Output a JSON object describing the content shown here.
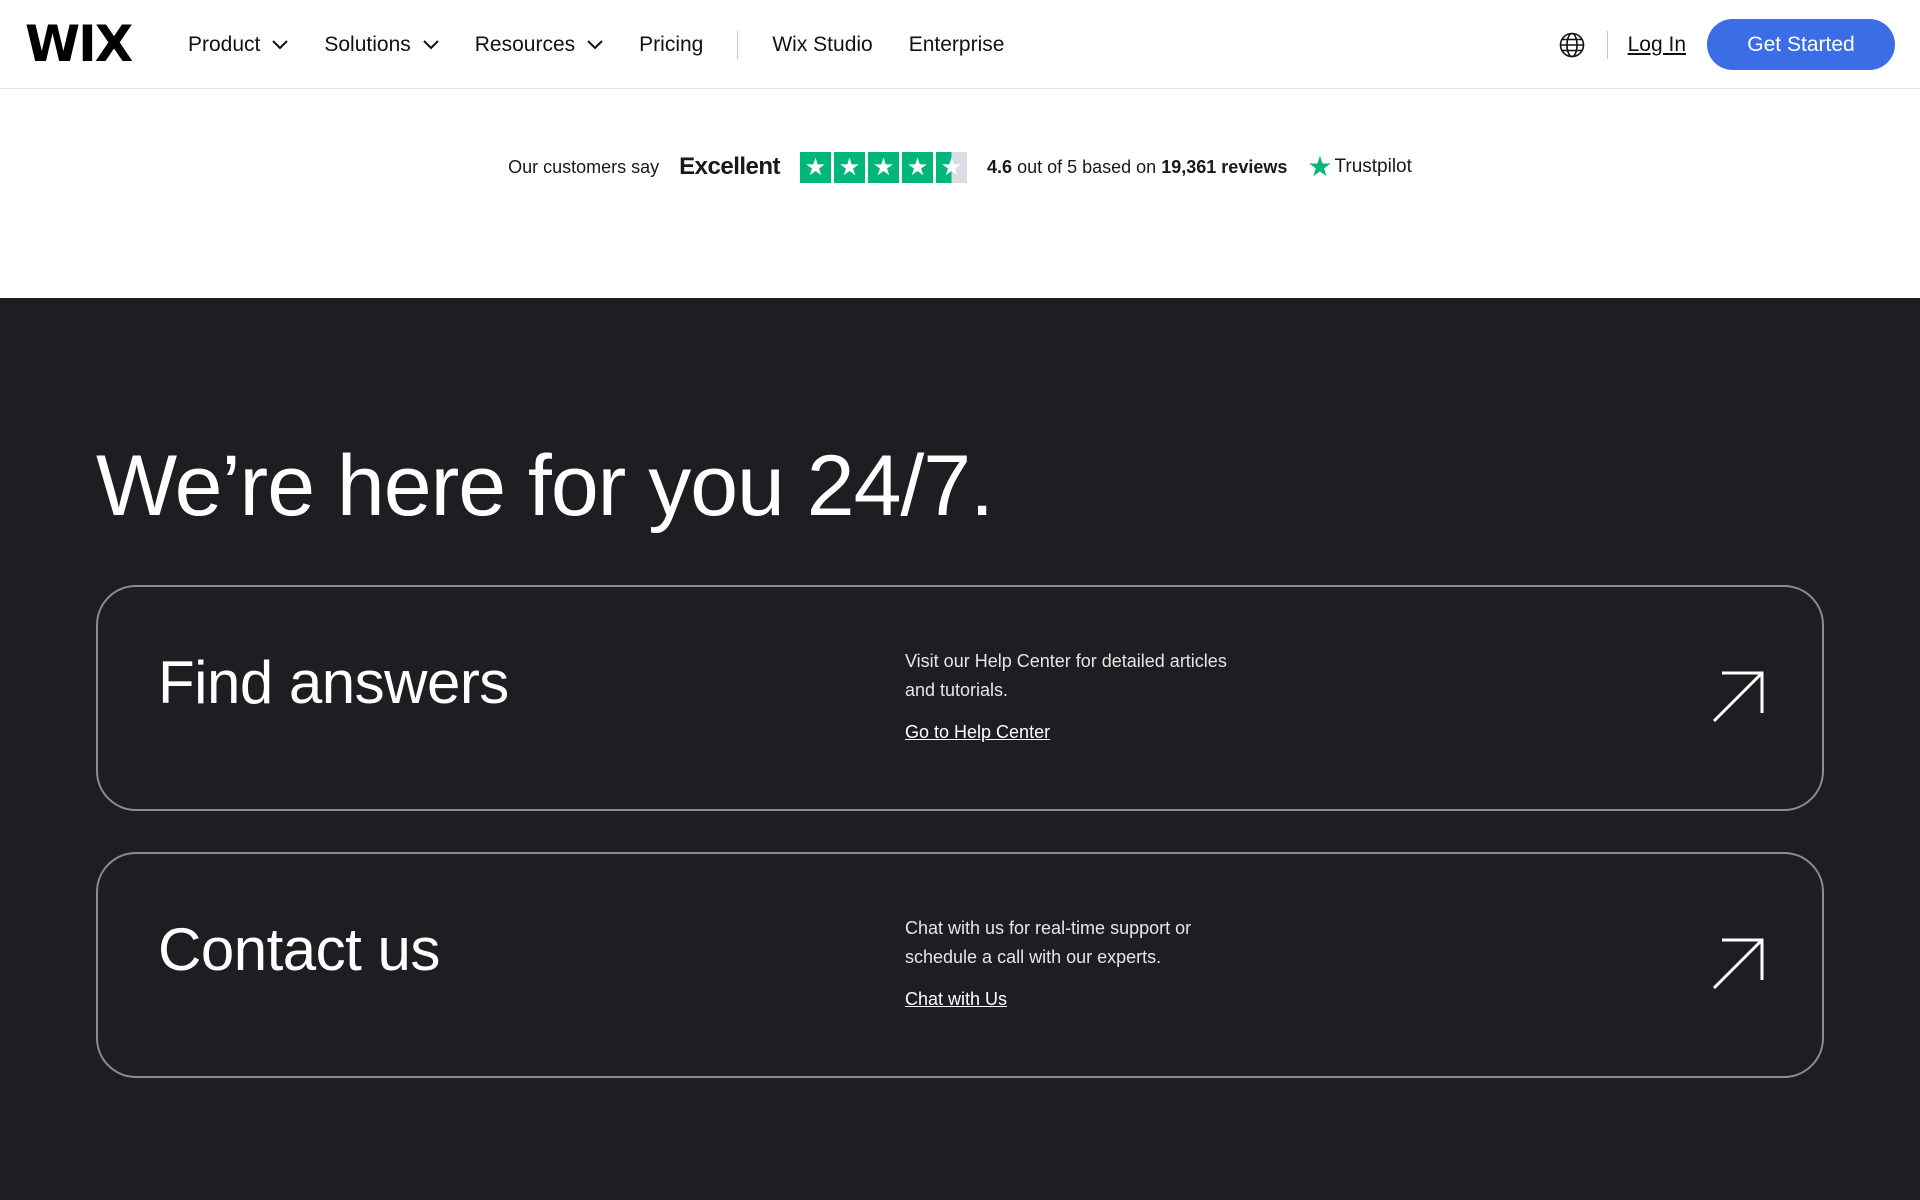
{
  "header": {
    "logo": "WIX",
    "nav": [
      {
        "label": "Product",
        "dropdown": true
      },
      {
        "label": "Solutions",
        "dropdown": true
      },
      {
        "label": "Resources",
        "dropdown": true
      },
      {
        "label": "Pricing",
        "dropdown": false
      }
    ],
    "nav_secondary": [
      {
        "label": "Wix Studio"
      },
      {
        "label": "Enterprise"
      }
    ],
    "login_label": "Log In",
    "cta_label": "Get Started",
    "cta_color": "#3b6ee6"
  },
  "trustpilot": {
    "intro": "Our customers say",
    "verdict": "Excellent",
    "rating_value": "4.6",
    "rating_text_1": "out of 5 based on",
    "review_count": "19,361",
    "rating_text_2": "reviews",
    "brand": "Trustpilot",
    "stars_filled": 4.5,
    "star_color": "#00b67a"
  },
  "support": {
    "headline": "We’re here for you 24/7.",
    "cards": [
      {
        "title": "Find answers",
        "description": "Visit our Help Center for detailed articles and tutorials.",
        "link": "Go to Help Center"
      },
      {
        "title": "Contact us",
        "description": "Chat with us for real-time support or schedule a call with our experts.",
        "link": "Chat with Us"
      }
    ],
    "background": "#1d1e21"
  }
}
